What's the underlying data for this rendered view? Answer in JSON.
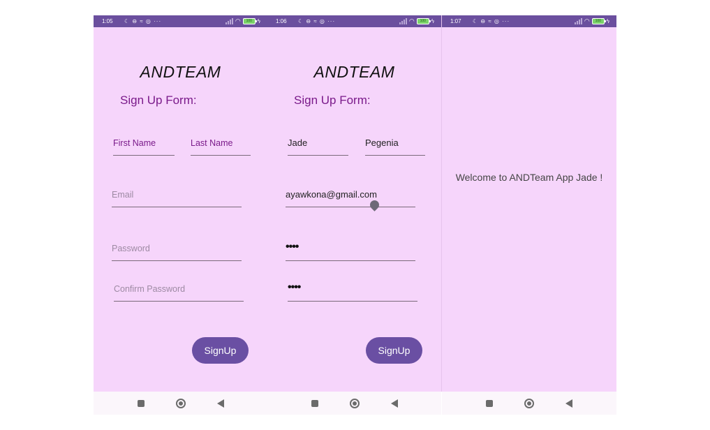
{
  "app_title": "ANDTEAM",
  "form_title": "Sign Up Form:",
  "signup_label": "SignUp",
  "status": {
    "times": [
      "1:05",
      "1:06",
      "1:07"
    ],
    "notification_icons": "☾ ⊖ ≈ ◎ ···",
    "battery": "100"
  },
  "screen1": {
    "first_name_hint": "First Name",
    "last_name_hint": "Last Name",
    "email_hint": "Email",
    "password_hint": "Password",
    "confirm_password_hint": "Confirm Password"
  },
  "screen2": {
    "first_name": "Jade",
    "last_name": "Pegenia",
    "email": "ayawkona@gmail.com",
    "password_masked": "••••",
    "confirm_password_masked": "••••"
  },
  "screen3": {
    "welcome": "Welcome to ANDTeam App Jade !"
  },
  "icons": {
    "nav": [
      "recents-icon",
      "home-icon",
      "back-icon"
    ],
    "status": [
      "moon-icon",
      "signal-icon",
      "wifi-icon",
      "battery-icon",
      "charging-icon"
    ]
  },
  "colors": {
    "background": "#f6d5fb",
    "statusbar": "#6b4f9e",
    "accent": "#6a4fa3",
    "form_title": "#7a1a8a"
  }
}
